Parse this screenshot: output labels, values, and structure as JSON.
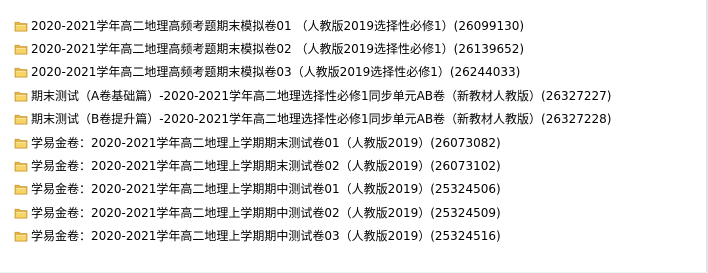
{
  "files": [
    {
      "icon": "folder-icon",
      "name": "2020-2021学年高二地理高频考题期末模拟卷01 （人教版2019选择性必修1）(26099130)"
    },
    {
      "icon": "folder-icon",
      "name": "2020-2021学年高二地理高频考题期末模拟卷02 （人教版2019选择性必修1）(26139652)"
    },
    {
      "icon": "folder-icon",
      "name": "2020-2021学年高二地理高频考题期末模拟卷03（人教版2019选择性必修1）(26244033)"
    },
    {
      "icon": "folder-icon",
      "name": "期末测试（A卷基础篇）-2020-2021学年高二地理选择性必修1同步单元AB卷（新教材人教版）(26327227)"
    },
    {
      "icon": "folder-icon",
      "name": "期末测试（B卷提升篇）-2020-2021学年高二地理选择性必修1同步单元AB卷（新教材人教版）(26327228)"
    },
    {
      "icon": "folder-icon",
      "name": "学易金卷：2020-2021学年高二地理上学期期末测试卷01（人教版2019）(26073082)"
    },
    {
      "icon": "folder-icon",
      "name": "学易金卷：2020-2021学年高二地理上学期期末测试卷02（人教版2019）(26073102)"
    },
    {
      "icon": "folder-icon",
      "name": "学易金卷：2020-2021学年高二地理上学期期中测试卷01（人教版2019）(25324506)"
    },
    {
      "icon": "folder-icon",
      "name": "学易金卷：2020-2021学年高二地理上学期期中测试卷02（人教版2019）(25324509)"
    },
    {
      "icon": "folder-icon",
      "name": "学易金卷：2020-2021学年高二地理上学期期中测试卷03（人教版2019）(25324516)"
    }
  ],
  "colors": {
    "folder_body": "#e7b94b",
    "folder_front": "#f6d46a",
    "folder_edge": "#c9952b"
  }
}
